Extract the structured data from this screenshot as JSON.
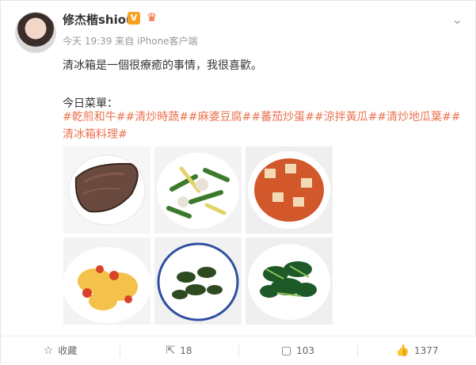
{
  "user": {
    "name": "修杰楷shiou",
    "verified_badge": "V"
  },
  "post_meta": {
    "time": "今天 19:39",
    "source": "来自 iPhone客户端"
  },
  "content": {
    "line1": "清冰箱是一個很療癒的事情，我很喜歡。",
    "line2": "今日菜單：",
    "tags": "#乾煎和牛##清炒時蔬##麻婆豆腐##蕃茄炒蛋##涼拌黃瓜##清炒地瓜葉##清冰箱料理#"
  },
  "images": [
    "seared-wagyu-steak",
    "stir-fried-vegetables",
    "mapo-tofu",
    "tomato-scrambled-egg",
    "cucumber-salad",
    "stir-fried-sweet-potato-leaves"
  ],
  "footer": {
    "favorite_label": "收藏",
    "repost_count": "18",
    "comment_count": "103",
    "like_count": "1377"
  },
  "colors": {
    "accent": "#eb7350",
    "text": "#333333",
    "meta": "#999999",
    "badge": "#f8a023"
  },
  "icons": [
    "chevron-down-icon",
    "crown-icon",
    "star-icon",
    "repost-icon",
    "comment-icon",
    "like-icon"
  ]
}
